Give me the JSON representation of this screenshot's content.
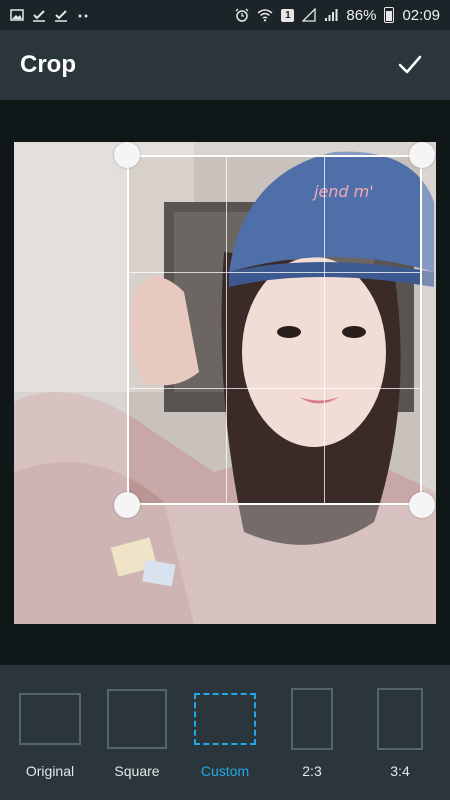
{
  "status_bar": {
    "battery": "86%",
    "time": "02:09",
    "sim_slot": "1",
    "icons": [
      "image-icon",
      "check-icon",
      "check-icon",
      "more-dots-icon",
      "alarm-icon",
      "wifi-icon",
      "signal-icon",
      "signal-icon"
    ]
  },
  "app_bar": {
    "title": "Crop",
    "done_icon": "check-icon"
  },
  "crop": {
    "subject_text_on_cap": "jend m'"
  },
  "aspect_options": [
    {
      "label": "Original",
      "active": false
    },
    {
      "label": "Square",
      "active": false
    },
    {
      "label": "Custom",
      "active": true
    },
    {
      "label": "2:3",
      "active": false
    },
    {
      "label": "3:4",
      "active": false
    }
  ],
  "colors": {
    "accent": "#1fa9e6",
    "toolbar_bg": "#2b363c",
    "workspace_bg": "#101719"
  }
}
